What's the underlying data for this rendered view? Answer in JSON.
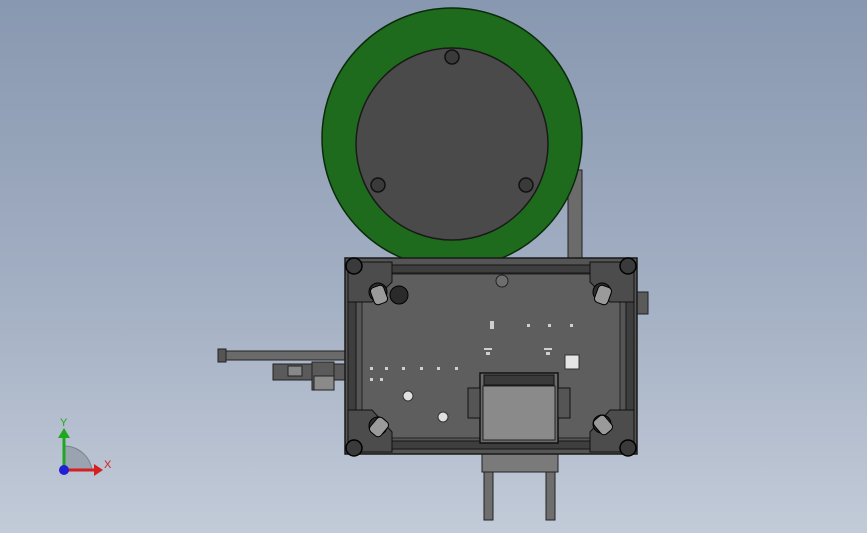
{
  "viewport": {
    "background_top": "#8898b0",
    "background_bottom": "#c2cbd8"
  },
  "model": {
    "ring_color": "#1e6b1e",
    "disc_color": "#4a4a4a",
    "frame_color": "#555555",
    "plate_color": "#5e5e5e"
  },
  "triad": {
    "x_label": "X",
    "y_label": "Y",
    "x_color": "#d42020",
    "y_color": "#1fa81f",
    "z_color": "#2020d4"
  }
}
